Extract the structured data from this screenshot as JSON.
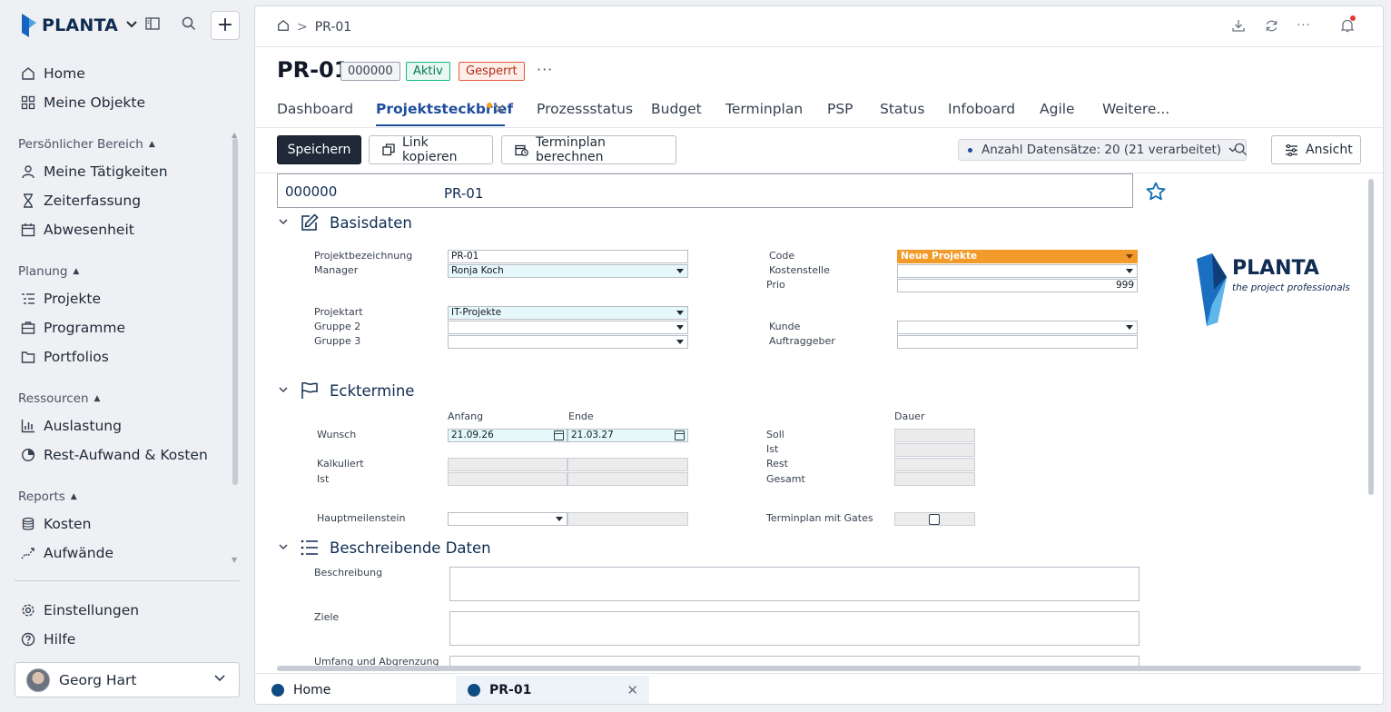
{
  "app": {
    "logo_text": "PLANTA",
    "plus_label": "+"
  },
  "sidebar": {
    "top_items": [
      {
        "label": "Home",
        "icon": "home-icon"
      },
      {
        "label": "Meine Objekte",
        "icon": "grid-icon"
      }
    ],
    "sections": [
      {
        "title": "Persönlicher Bereich",
        "items": [
          {
            "label": "Meine Tätigkeiten",
            "icon": "user-icon"
          },
          {
            "label": "Zeiterfassung",
            "icon": "hourglass-icon"
          },
          {
            "label": "Abwesenheit",
            "icon": "calendar-icon"
          }
        ]
      },
      {
        "title": "Planung",
        "items": [
          {
            "label": "Projekte",
            "icon": "project-list-icon"
          },
          {
            "label": "Programme",
            "icon": "briefcase-icon"
          },
          {
            "label": "Portfolios",
            "icon": "folder-icon"
          }
        ]
      },
      {
        "title": "Ressourcen",
        "items": [
          {
            "label": "Auslastung",
            "icon": "bar-chart-icon"
          },
          {
            "label": "Rest-Aufwand & Kosten",
            "icon": "pie-chart-icon"
          }
        ]
      },
      {
        "title": "Reports",
        "items": [
          {
            "label": "Kosten",
            "icon": "coins-icon"
          },
          {
            "label": "Aufwände",
            "icon": "trend-icon"
          }
        ]
      }
    ],
    "bottom_items": [
      {
        "label": "Einstellungen",
        "icon": "gear-icon"
      },
      {
        "label": "Hilfe",
        "icon": "help-icon"
      }
    ],
    "user": {
      "name": "Georg Hart"
    }
  },
  "header": {
    "breadcrumb": "PR-01",
    "title": "PR-01",
    "badges": {
      "code": "000000",
      "status": "Aktiv",
      "lock": "Gesperrt"
    },
    "more": "···"
  },
  "tabs": [
    {
      "label": "Dashboard"
    },
    {
      "label": "Projektsteckbrief",
      "active": true
    },
    {
      "label": "Prozessstatus"
    },
    {
      "label": "Budget"
    },
    {
      "label": "Terminplan"
    },
    {
      "label": "PSP"
    },
    {
      "label": "Status"
    },
    {
      "label": "Infoboard"
    },
    {
      "label": "Agile"
    },
    {
      "label": "Weitere..."
    }
  ],
  "toolbar": {
    "save_label": "Speichern",
    "copy_link_label": "Link kopieren",
    "calc_label": "Terminplan berechnen",
    "records_label": "Anzahl Datensätze: 20 (21 verarbeitet)",
    "view_label": "Ansicht"
  },
  "form": {
    "head_code": "000000",
    "head_name": "PR-01",
    "basisdaten": {
      "title": "Basisdaten",
      "labels": {
        "projektbezeichnung": "Projektbezeichnung",
        "manager": "Manager",
        "projektart": "Projektart",
        "gruppe2": "Gruppe 2",
        "gruppe3": "Gruppe 3",
        "code": "Code",
        "kostenstelle": "Kostenstelle",
        "prio": "Prio",
        "kunde": "Kunde",
        "auftraggeber": "Auftraggeber"
      },
      "values": {
        "projektbezeichnung": "PR-01",
        "manager": "Ronja Koch",
        "projektart": "IT-Projekte",
        "code": "Neue Projekte",
        "prio": "999"
      }
    },
    "ecktermine": {
      "title": "Ecktermine",
      "labels": {
        "anfang": "Anfang",
        "ende": "Ende",
        "dauer": "Dauer",
        "wunsch": "Wunsch",
        "kalkuliert": "Kalkuliert",
        "ist": "Ist",
        "soll": "Soll",
        "ist2": "Ist",
        "rest": "Rest",
        "gesamt": "Gesamt",
        "hauptmeilenstein": "Hauptmeilenstein",
        "terminplan_gates": "Terminplan mit Gates"
      },
      "values": {
        "wunsch_anfang": "21.09.26",
        "wunsch_ende": "21.03.27"
      }
    },
    "beschreibende": {
      "title": "Beschreibende Daten",
      "labels": {
        "beschreibung": "Beschreibung",
        "ziele": "Ziele",
        "umfang": "Umfang und Abgrenzung"
      }
    },
    "logo": {
      "word": "PLANTA",
      "tagline": "the project professionals"
    }
  },
  "bottom_tabs": [
    {
      "label": "Home"
    },
    {
      "label": "PR-01",
      "active": true
    }
  ],
  "colors": {
    "accent": "#1e4e9c",
    "brand_dark": "#0f2c52",
    "code_orange": "#f29b2a",
    "aktiv_green": "#047857",
    "gesperrt_red": "#b42d14"
  }
}
